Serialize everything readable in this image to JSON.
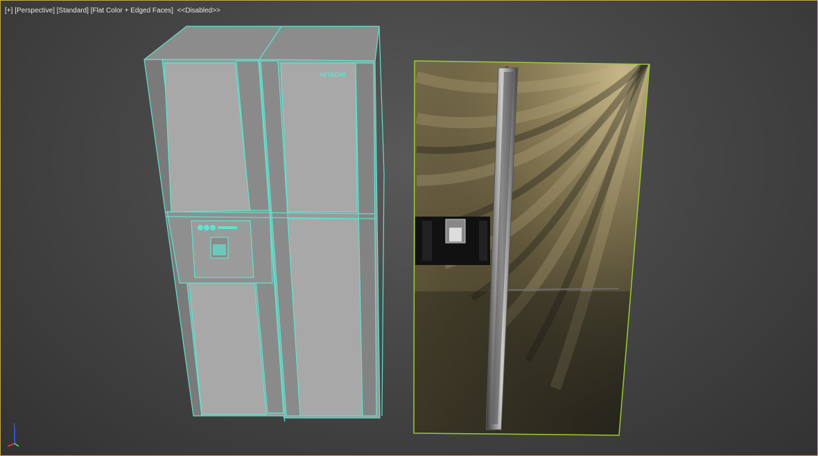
{
  "viewport": {
    "menu_plus": "[+]",
    "view_mode": "[Perspective]",
    "shading_style": "[Standard]",
    "render_mode": "[Flat Color + Edged Faces]",
    "lighting_state": "<<Disabled>>"
  },
  "left_model": {
    "brand_text": "HITACHI",
    "wire_color": "#5fe3cf",
    "face_color": "#9a9a9a"
  },
  "right_model": {
    "selection_color": "#9acd32",
    "body_tone": "#6a5e3a"
  },
  "axis_gizmo": {
    "x": "x",
    "y": "y",
    "z": "z"
  }
}
